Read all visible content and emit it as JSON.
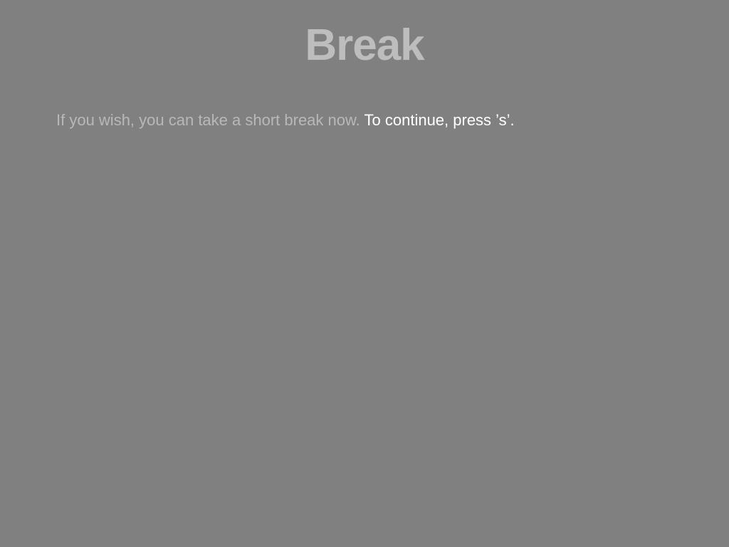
{
  "screen": {
    "title": "Break",
    "instruction_muted": "If you wish, you can take a short break now.",
    "instruction_emph": "To continue, press ’s’."
  },
  "colors": {
    "background": "#808080",
    "title": "#bdbdbd",
    "muted_text": "#b8b8b8",
    "emphasis_text": "#ffffff"
  }
}
